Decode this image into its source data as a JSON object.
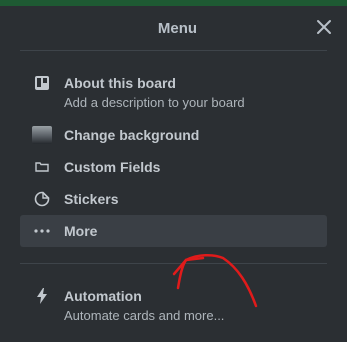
{
  "menu": {
    "title": "Menu",
    "items": [
      {
        "label": "About this board",
        "sublabel": "Add a description to your board",
        "icon": "board-icon"
      },
      {
        "label": "Change background",
        "icon": "background-thumbnail"
      },
      {
        "label": "Custom Fields",
        "icon": "card-icon"
      },
      {
        "label": "Stickers",
        "icon": "sticker-icon"
      },
      {
        "label": "More",
        "icon": "ellipsis-icon"
      }
    ],
    "automation": {
      "label": "Automation",
      "sublabel": "Automate cards and more...",
      "icon": "lightning-icon"
    }
  },
  "colors": {
    "panel_bg": "#2b2f33",
    "hover_bg": "#3a3f45",
    "text": "#c2c8ce",
    "annotation": "#e01b1b"
  }
}
